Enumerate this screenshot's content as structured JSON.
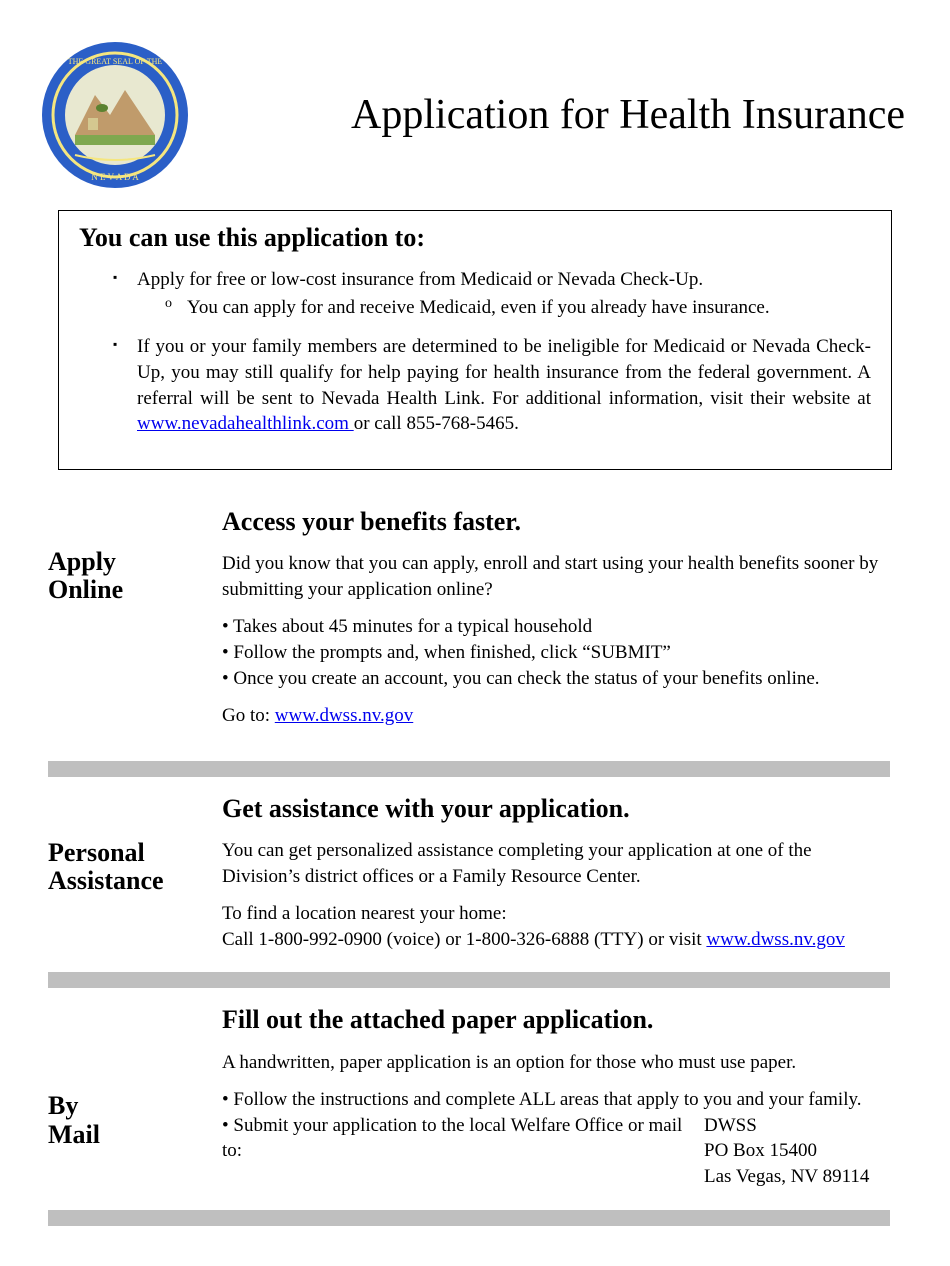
{
  "title": "Application for Health Insurance",
  "seal_label": "Great Seal of the State of Nevada",
  "info_box": {
    "heading": "You can use this application to:",
    "item1": "Apply for free or low-cost insurance from Medicaid or Nevada Check-Up.",
    "sub1": "You can apply for and receive Medicaid, even if you already have  insurance.",
    "item2_a": "If you or your family members are determined to be ineligible for Medicaid or Nevada Check-Up, you may still qualify for help paying for health insurance from the federal government. A referral will be sent to Nevada Health Link. For additional information, visit their website at ",
    "item2_link": "www.nevadahealthlink.com ",
    "item2_b": "or call 855-768-5465."
  },
  "apply_online": {
    "label_line1": "Apply",
    "label_line2": "Online",
    "heading": "Access your benefits faster.",
    "intro": "Did you know that you can apply, enroll and start using your health benefits sooner by submitting your application online?",
    "b1": "• Takes about 45 minutes for a typical household",
    "b2": "• Follow the prompts and, when finished, click “SUBMIT”",
    "b3": "• Once you create an account, you can check the status of your benefits online.",
    "goto_prefix": "Go to: ",
    "goto_link": "www.dwss.nv.gov"
  },
  "personal_assistance": {
    "label_line1": "Personal",
    "label_line2": "Assistance",
    "heading": "Get assistance with your application.",
    "p1": "You can get personalized assistance completing your application at one of the Division’s district offices or a Family Resource Center.",
    "p2_a": "To find a location nearest your home:",
    "p2_b": "Call 1-800-992-0900 (voice) or 1-800-326-6888 (TTY) or visit ",
    "p2_link": "www.dwss.nv.gov"
  },
  "by_mail": {
    "label_line1": "By",
    "label_line2": "Mail",
    "heading": "Fill out the attached paper application.",
    "intro": "A handwritten, paper application is an option for those who must use paper.",
    "b1": "• Follow the instructions and complete ALL areas that apply to you and your family.",
    "b2": "• Submit your application to the local Welfare Office or mail to:",
    "addr1": "DWSS",
    "addr2": "PO Box 15400",
    "addr3": "Las Vegas, NV 89114"
  }
}
